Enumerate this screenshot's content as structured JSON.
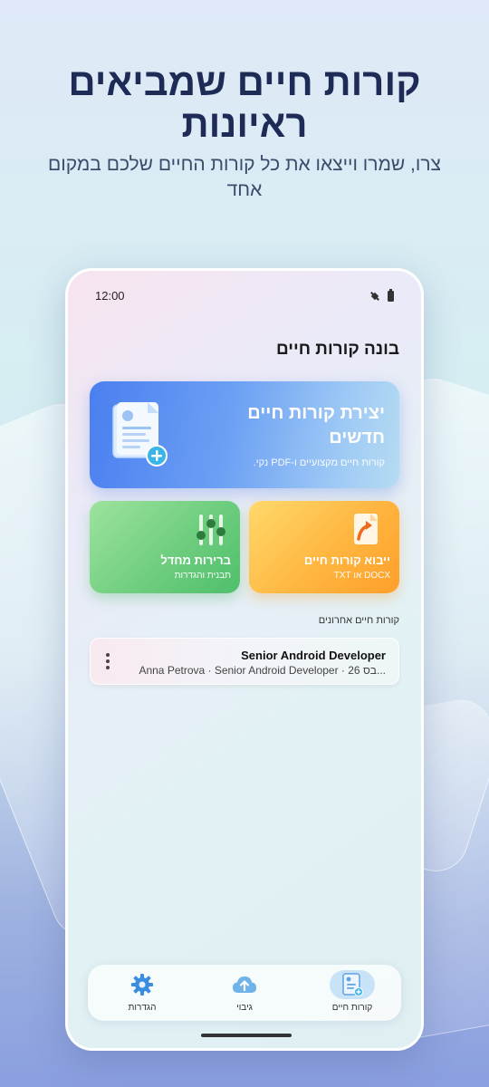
{
  "promo": {
    "headline": "קורות חיים שמביאים ראיונות",
    "subline": "צרו, שמרו וייצאו את כל קורות החיים שלכם במקום אחד"
  },
  "status_bar": {
    "time": "12:00"
  },
  "app": {
    "title": "בונה קורות חיים"
  },
  "create_card": {
    "title": "יצירת קורות חיים חדשים",
    "description": "קורות חיים מקצועיים ו-PDF נקי.",
    "icon": "document-add-icon"
  },
  "import_card": {
    "title": "ייבוא קורות חיים",
    "subtitle": "DOCX או TXT",
    "icon": "file-import-icon"
  },
  "defaults_card": {
    "title": "ברירות מחדל",
    "subtitle": "תבנית והגדרות",
    "icon": "sliders-icon"
  },
  "recent": {
    "label": "קורות חיים אחרונים",
    "items": [
      {
        "title": "Senior Android Developer",
        "meta": "Anna Petrova · Senior Android Developer · 26 בס..."
      }
    ]
  },
  "nav": {
    "items": [
      {
        "label": "קורות חיים",
        "icon": "resume-icon",
        "active": true
      },
      {
        "label": "גיבוי",
        "icon": "cloud-upload-icon",
        "active": false
      },
      {
        "label": "הגדרות",
        "icon": "gear-icon",
        "active": false
      }
    ]
  },
  "colors": {
    "create_card": "#4a7ff0",
    "import_card": "#ffb640",
    "defaults_card": "#6fce7f",
    "headline": "#1e2b57"
  }
}
